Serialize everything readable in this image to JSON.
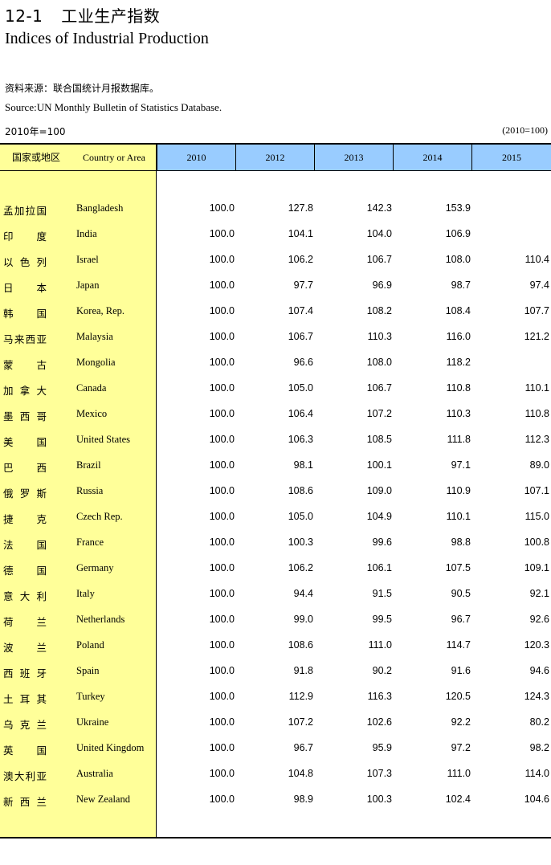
{
  "header": {
    "number": "12-1",
    "title_cn": "工业生产指数",
    "title_en": "Indices of Industrial Production",
    "source_cn": "资料来源：联合国统计月报数据库。",
    "source_en": "Source:UN Monthly Bulletin of Statistics Database.",
    "base_left": "2010年=100",
    "base_right": "(2010=100)"
  },
  "table": {
    "col_cn": "国家或地区",
    "col_en": "Country or Area",
    "years": [
      "2010",
      "2012",
      "2013",
      "2014",
      "2015"
    ],
    "rows": [
      {
        "cn": "孟加拉国",
        "en": "Bangladesh",
        "v": [
          "100.0",
          "127.8",
          "142.3",
          "153.9",
          ""
        ]
      },
      {
        "cn": "印度",
        "en": "India",
        "v": [
          "100.0",
          "104.1",
          "104.0",
          "106.9",
          ""
        ]
      },
      {
        "cn": "以色列",
        "en": "Israel",
        "v": [
          "100.0",
          "106.2",
          "106.7",
          "108.0",
          "110.4"
        ]
      },
      {
        "cn": "日本",
        "en": "Japan",
        "v": [
          "100.0",
          "97.7",
          "96.9",
          "98.7",
          "97.4"
        ]
      },
      {
        "cn": "韩国",
        "en": "Korea, Rep.",
        "v": [
          "100.0",
          "107.4",
          "108.2",
          "108.4",
          "107.7"
        ]
      },
      {
        "cn": "马来西亚",
        "en": "Malaysia",
        "v": [
          "100.0",
          "106.7",
          "110.3",
          "116.0",
          "121.2"
        ]
      },
      {
        "cn": "蒙古",
        "en": "Mongolia",
        "v": [
          "100.0",
          "96.6",
          "108.0",
          "118.2",
          ""
        ]
      },
      {
        "cn": "加拿大",
        "en": "Canada",
        "v": [
          "100.0",
          "105.0",
          "106.7",
          "110.8",
          "110.1"
        ]
      },
      {
        "cn": "墨西哥",
        "en": "Mexico",
        "v": [
          "100.0",
          "106.4",
          "107.2",
          "110.3",
          "110.8"
        ]
      },
      {
        "cn": "美国",
        "en": "United States",
        "v": [
          "100.0",
          "106.3",
          "108.5",
          "111.8",
          "112.3"
        ]
      },
      {
        "cn": "巴西",
        "en": "Brazil",
        "v": [
          "100.0",
          "98.1",
          "100.1",
          "97.1",
          "89.0"
        ]
      },
      {
        "cn": "俄罗斯",
        "en": "Russia",
        "v": [
          "100.0",
          "108.6",
          "109.0",
          "110.9",
          "107.1"
        ]
      },
      {
        "cn": "捷克",
        "en": "Czech Rep.",
        "v": [
          "100.0",
          "105.0",
          "104.9",
          "110.1",
          "115.0"
        ]
      },
      {
        "cn": "法国",
        "en": "France",
        "v": [
          "100.0",
          "100.3",
          "99.6",
          "98.8",
          "100.8"
        ]
      },
      {
        "cn": "德国",
        "en": "Germany",
        "v": [
          "100.0",
          "106.2",
          "106.1",
          "107.5",
          "109.1"
        ]
      },
      {
        "cn": "意大利",
        "en": "Italy",
        "v": [
          "100.0",
          "94.4",
          "91.5",
          "90.5",
          "92.1"
        ]
      },
      {
        "cn": "荷兰",
        "en": "Netherlands",
        "v": [
          "100.0",
          "99.0",
          "99.5",
          "96.7",
          "92.6"
        ]
      },
      {
        "cn": "波兰",
        "en": "Poland",
        "v": [
          "100.0",
          "108.6",
          "111.0",
          "114.7",
          "120.3"
        ]
      },
      {
        "cn": "西班牙",
        "en": "Spain",
        "v": [
          "100.0",
          "91.8",
          "90.2",
          "91.6",
          "94.6"
        ]
      },
      {
        "cn": "土耳其",
        "en": "Turkey",
        "v": [
          "100.0",
          "112.9",
          "116.3",
          "120.5",
          "124.3"
        ]
      },
      {
        "cn": "乌克兰",
        "en": "Ukraine",
        "v": [
          "100.0",
          "107.2",
          "102.6",
          "92.2",
          "80.2"
        ]
      },
      {
        "cn": "英国",
        "en": "United Kingdom",
        "v": [
          "100.0",
          "96.7",
          "95.9",
          "97.2",
          "98.2"
        ]
      },
      {
        "cn": "澳大利亚",
        "en": "Australia",
        "v": [
          "100.0",
          "104.8",
          "107.3",
          "111.0",
          "114.0"
        ]
      },
      {
        "cn": "新西兰",
        "en": "New Zealand",
        "v": [
          "100.0",
          "98.9",
          "100.3",
          "102.4",
          "104.6"
        ]
      }
    ]
  },
  "colors": {
    "country_column": "#ffff99",
    "year_header": "#99ccff"
  }
}
